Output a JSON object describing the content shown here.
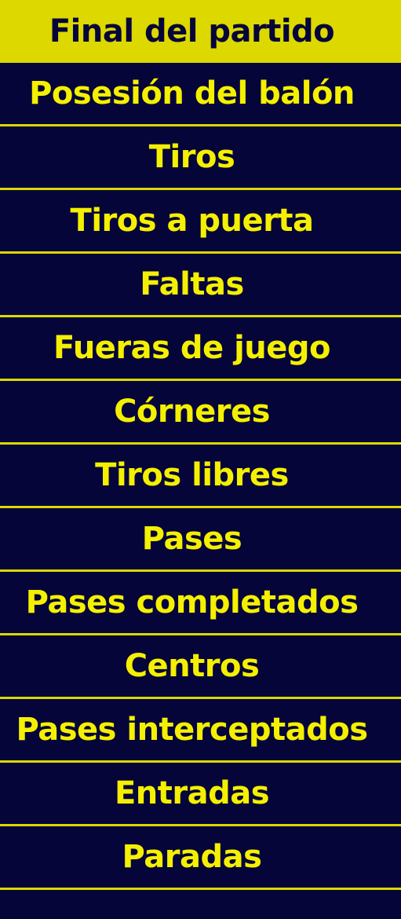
{
  "colors": {
    "accent": "#dcd800",
    "background": "#06053a",
    "text": "#f4f000"
  },
  "header": {
    "title": "Final del partido"
  },
  "stats": [
    {
      "label": "Posesión del balón"
    },
    {
      "label": "Tiros"
    },
    {
      "label": "Tiros a puerta"
    },
    {
      "label": "Faltas"
    },
    {
      "label": "Fueras de juego"
    },
    {
      "label": "Córneres"
    },
    {
      "label": "Tiros libres"
    },
    {
      "label": "Pases"
    },
    {
      "label": "Pases completados"
    },
    {
      "label": "Centros"
    },
    {
      "label": "Pases interceptados"
    },
    {
      "label": "Entradas"
    },
    {
      "label": "Paradas"
    }
  ]
}
